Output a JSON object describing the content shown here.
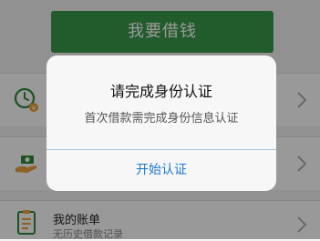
{
  "main": {
    "borrow_button": "我要借钱",
    "menu": [
      {
        "icon": "clock-coin-icon",
        "title": "",
        "subtitle": ""
      },
      {
        "icon": "hand-money-icon",
        "title": "",
        "subtitle": ""
      },
      {
        "icon": "clipboard-icon",
        "title": "我的账单",
        "subtitle": "无历史借款记录"
      }
    ]
  },
  "dialog": {
    "title": "请完成身份认证",
    "message": "首次借款需完成身份信息认证",
    "action": "开始认证"
  },
  "colors": {
    "primary_green": "#3b9a4a",
    "link_blue": "#1a7ad6",
    "overlay": "rgba(0,0,0,0.40)"
  }
}
